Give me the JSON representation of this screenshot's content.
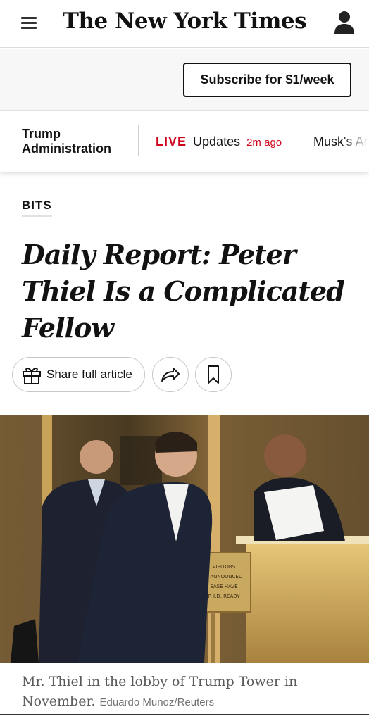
{
  "header": {
    "logo_text": "The New York Times",
    "menu_icon": "hamburger-menu-icon",
    "account_icon": "user-account-icon"
  },
  "subscribe": {
    "label": "Subscribe for $1/week"
  },
  "newsbar": {
    "section_label": "Trump Administration",
    "live_tag": "LIVE",
    "live_text": "Updates",
    "live_time": "2m ago",
    "next_item": "Musk's Ar"
  },
  "article": {
    "kicker": "BITS",
    "headline": "Daily Report: Peter Thiel Is a Complicated Fellow",
    "share_label": "Share full article",
    "gift_icon": "gift-icon",
    "forward_icon": "share-arrow-icon",
    "bookmark_icon": "bookmark-icon",
    "photo_sign": [
      "VISITORS",
      "E ANNOUNCED",
      "EASE HAVE",
      "P. I.D. READY"
    ],
    "caption": "Mr. Thiel in the lobby of Trump Tower in November.",
    "credit": "Eduardo Munoz/Reuters"
  },
  "colors": {
    "live_red": "#d0021b",
    "text_dark": "#121212",
    "caption_gray": "#5a5a5a"
  }
}
